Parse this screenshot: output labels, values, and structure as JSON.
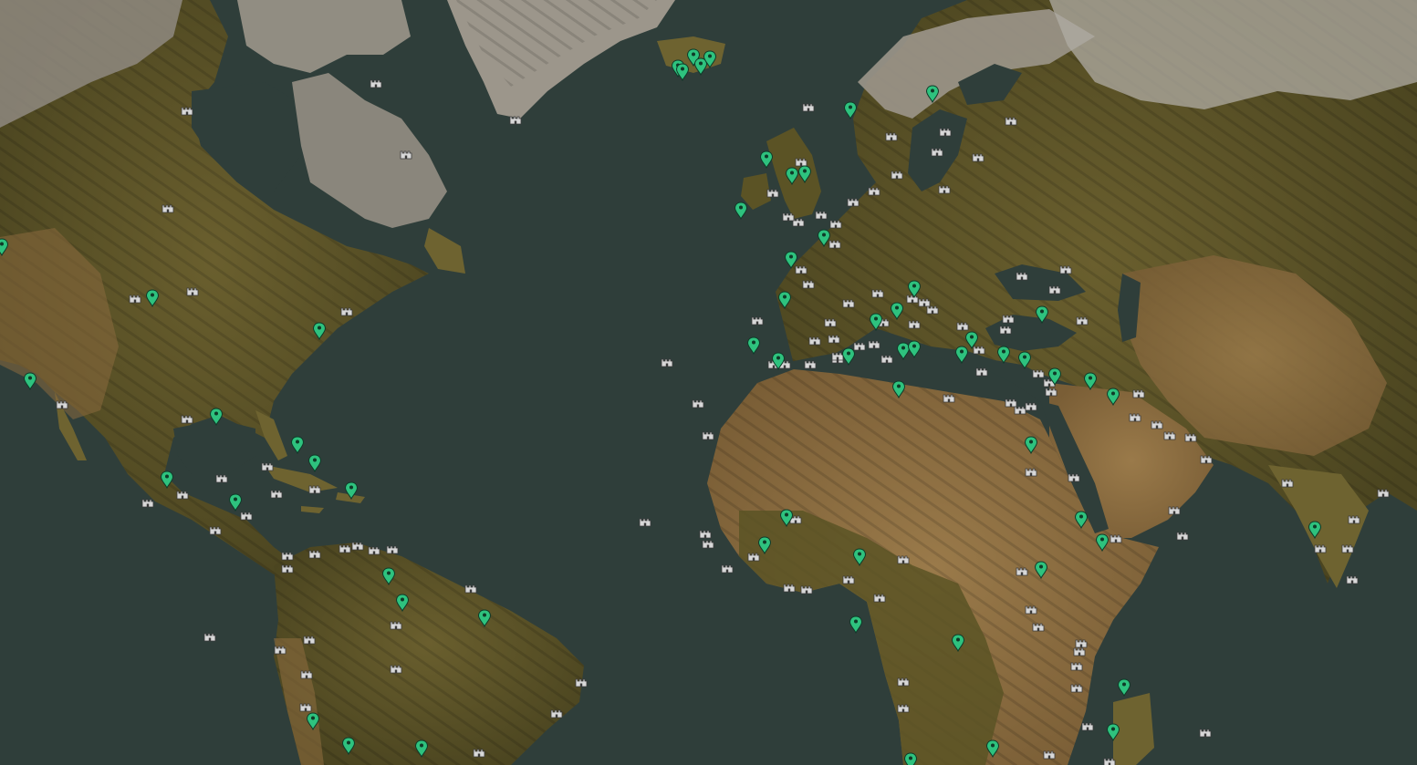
{
  "map": {
    "view": "world-map-atlantic",
    "colors": {
      "ocean": "#2f3e3a",
      "land_green": "#5b5325",
      "land_olive": "#6e6330",
      "desert": "#8a6a3e",
      "mountain": "#8f8a80",
      "snow": "#b9b6b0",
      "marker_green": "#2ec27e",
      "marker_white": "#d8d8d8"
    }
  },
  "markers": {
    "quest_icon": "map-pin-icon",
    "settlement_icon": "castle-icon",
    "quest_count": 56,
    "settlement_count": 134
  }
}
